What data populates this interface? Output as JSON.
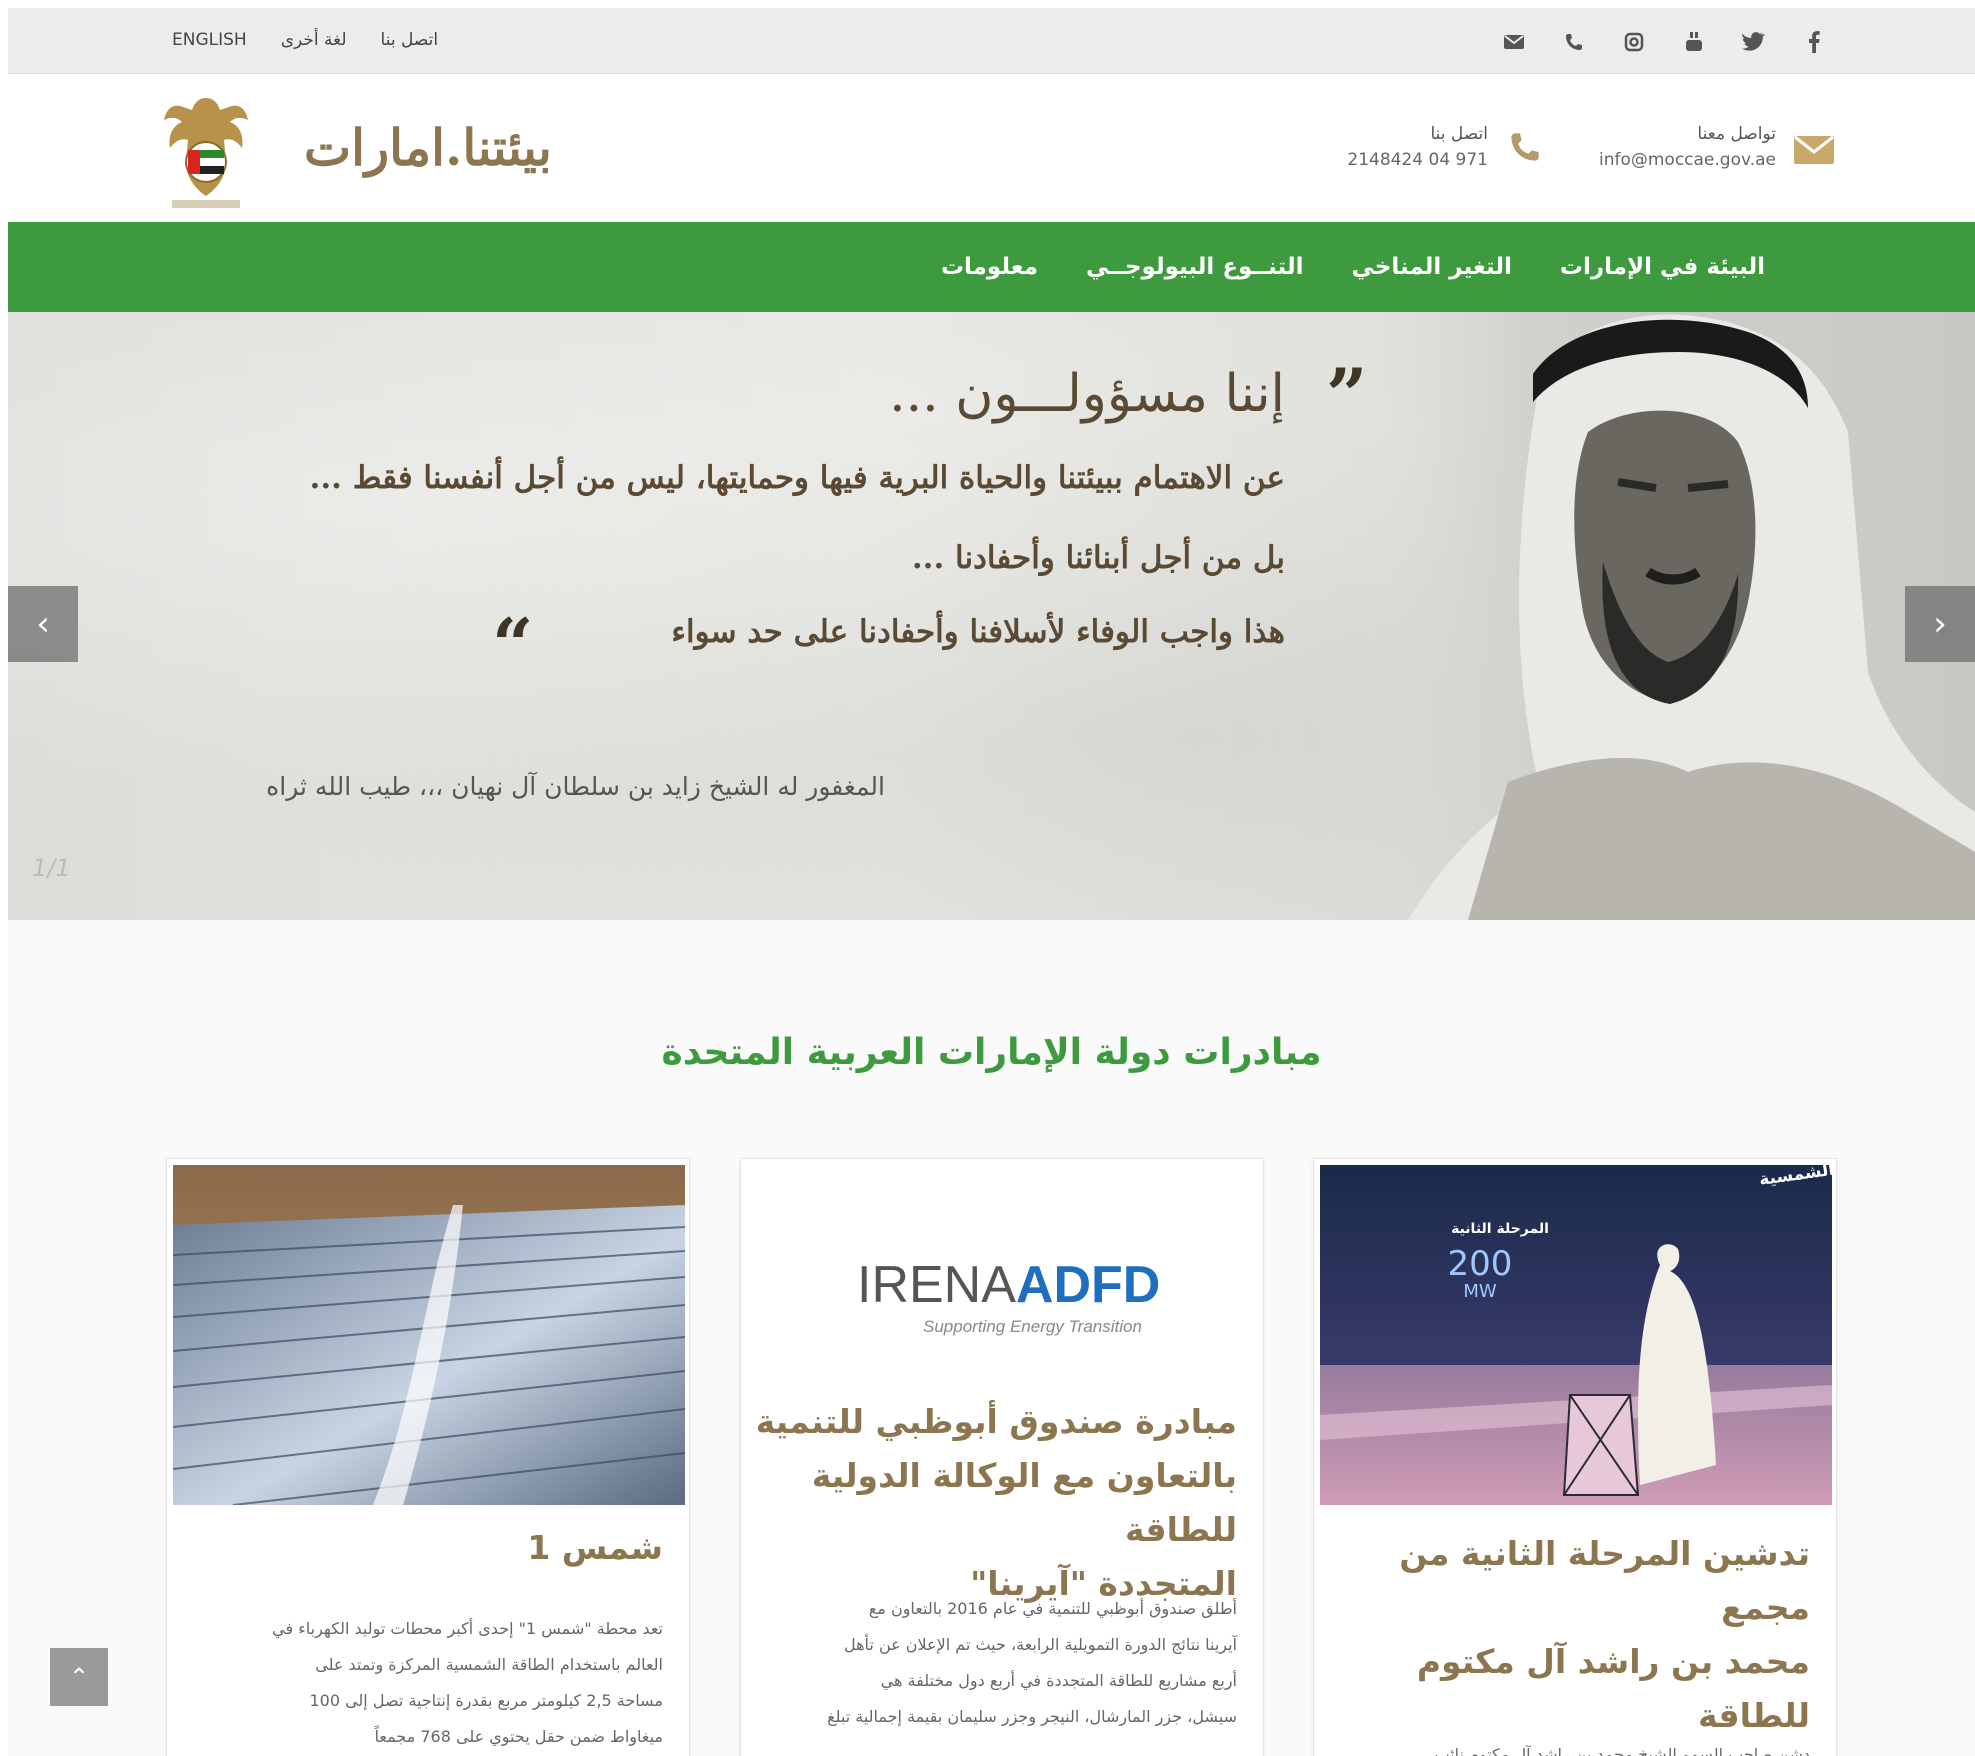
{
  "topbar": {
    "links": [
      "ENGLISH",
      "لغة أخرى",
      "اتصل بنا"
    ],
    "social_icons": [
      "envelope-icon",
      "phone-icon",
      "instagram-icon",
      "youtube-icon",
      "twitter-icon",
      "facebook-icon"
    ]
  },
  "header": {
    "brand": "بيئتنا.امارات",
    "contact_mail_label": "تواصل معنا",
    "contact_mail_value": "info@moccae.gov.ae",
    "contact_phone_label": "اتصل بنا",
    "contact_phone_value": "2148424 04 971",
    "accent_color": "#8c7650"
  },
  "nav": {
    "color": "#3e9a3e",
    "items": [
      "البيئة في الإمارات",
      "التغير المناخي",
      "التنــوع البيولوجــي",
      "معلومات"
    ]
  },
  "hero": {
    "quote_heading": "إننا مسؤولـــون ...",
    "quote_line1": "عن الاهتمام ببيئتنا والحياة البرية فيها وحمايتها، ليس من أجل أنفسنا فقط ...",
    "quote_line2": "بل من أجل أبنائنا وأحفادنا ...",
    "quote_line3": "هذا واجب الوفاء لأسلافنا وأحفادنا على حد سواء",
    "quote_open": "”",
    "quote_close": "“",
    "attribution": "المغفور له الشيخ زايد بن سلطان آل نهيان ،،، طيب الله ثراه",
    "slide_counter": "1/1",
    "prev_label": "‹",
    "next_label": "›"
  },
  "section": {
    "title": "مبادرات دولة الإمارات العربية المتحدة"
  },
  "cards": [
    {
      "title_lines": [
        "تدشين المرحلة الثانية من مجمع",
        "محمد بن راشد آل مكتوم للطاقة",
        "الشمسية"
      ],
      "text_lines": [
        "دشن صاحب السمو الشيخ محمد بن راشد آل مكتوم نائب"
      ],
      "image_caption_top": "مجمع محمد بن راشد آل مكتوم للطاقة الشمسية",
      "image_caption_sub": "المرحلة الثانية",
      "image_value": "200",
      "image_unit": "MW"
    },
    {
      "logo_left": "IRENA",
      "logo_right": "ADFD",
      "logo_tagline": "Supporting Energy Transition",
      "title_lines": [
        "مبادرة صندوق أبوظبي للتنمية",
        "بالتعاون مع الوكالة الدولية للطاقة",
        "المتجددة \"آيرينا\""
      ],
      "text_lines": [
        "أطلق صندوق أبوظبي للتنمية في عام 2016 بالتعاون مع",
        "آيرينا نتائج الدورة التمويلية الرابعة، حيث تم الإعلان عن تأهل",
        "أربع مشاريع للطاقة المتجددة في أربع دول مختلفة هي",
        "سيشل، جزر المارشال، النيجر وجزر سليمان بقيمة إجمالية تبلغ"
      ]
    },
    {
      "title_lines": [
        "شمس 1"
      ],
      "text_lines": [
        "تعد محطة \"شمس 1\" إحدى أكبر محطات توليد الكهرباء في",
        "العالم باستخدام الطاقة الشمسية المركزة وتمتد على",
        "مساحة 2,5 كيلومتر مربع بقدرة إنتاجية تصل إلى 100",
        "ميغاواط ضمن حقل يحتوي على 768 مجمعاً"
      ]
    }
  ],
  "scroll_top_label": "⌃"
}
